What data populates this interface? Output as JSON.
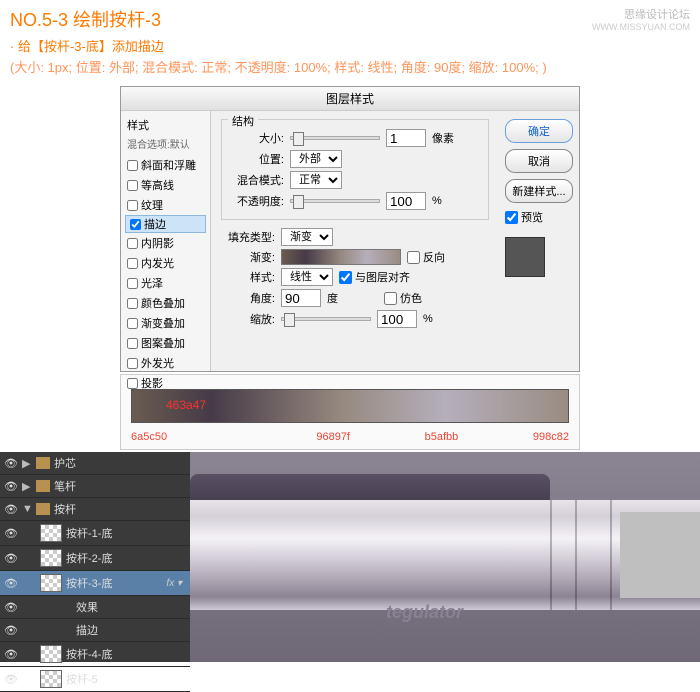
{
  "header": {
    "title": "NO.5-3 绘制按杆-3",
    "subtitle": "· 给【按杆-3-底】添加描边",
    "params": "(大小: 1px; 位置: 外部; 混合模式: 正常; 不透明度: 100%; 样式: 线性; 角度: 90度; 缩放: 100%; )",
    "watermark": "思缘设计论坛",
    "watermark_url": "WWW.MISSYUAN.COM"
  },
  "dialog": {
    "title": "图层样式",
    "left_head": "样式",
    "left_sub": "混合选项:默认",
    "styles": [
      {
        "label": "斜面和浮雕",
        "checked": false
      },
      {
        "label": "等高线",
        "checked": false
      },
      {
        "label": "纹理",
        "checked": false
      },
      {
        "label": "描边",
        "checked": true,
        "selected": true
      },
      {
        "label": "内阴影",
        "checked": false
      },
      {
        "label": "内发光",
        "checked": false
      },
      {
        "label": "光泽",
        "checked": false
      },
      {
        "label": "颜色叠加",
        "checked": false
      },
      {
        "label": "渐变叠加",
        "checked": false
      },
      {
        "label": "图案叠加",
        "checked": false
      },
      {
        "label": "外发光",
        "checked": false
      },
      {
        "label": "投影",
        "checked": false
      }
    ],
    "section_stroke": "描边",
    "group_struct": "结构",
    "size_label": "大小:",
    "size_val": "1",
    "size_unit": "像素",
    "pos_label": "位置:",
    "pos_val": "外部",
    "blend_label": "混合模式:",
    "blend_val": "正常",
    "opacity_label": "不透明度:",
    "opacity_val": "100",
    "pct": "%",
    "fill_label": "填充类型:",
    "fill_val": "渐变",
    "grad_label": "渐变:",
    "reverse": "反向",
    "style_label": "样式:",
    "style_val": "线性",
    "align": "与图层对齐",
    "angle_label": "角度:",
    "angle_val": "90",
    "deg": "度",
    "dither": "仿色",
    "scale_label": "缩放:",
    "scale_val": "100",
    "btn_ok": "确定",
    "btn_cancel": "取消",
    "btn_new": "新建样式...",
    "preview": "预览"
  },
  "gradient": {
    "inner": "463a47",
    "stops": [
      "6a5c50",
      "",
      "96897f",
      "b5afbb",
      "998c82"
    ]
  },
  "layers": {
    "items": [
      {
        "type": "folder",
        "name": "护芯"
      },
      {
        "type": "folder",
        "name": "笔杆"
      },
      {
        "type": "folder",
        "name": "按杆",
        "open": true
      },
      {
        "type": "layer",
        "name": "按杆-1-底",
        "indent": 1
      },
      {
        "type": "layer",
        "name": "按杆-2-底",
        "indent": 1
      },
      {
        "type": "layer",
        "name": "按杆-3-底",
        "indent": 1,
        "selected": true,
        "fx": "fx"
      },
      {
        "type": "fx",
        "name": "效果",
        "indent": 2
      },
      {
        "type": "fx",
        "name": "描边",
        "indent": 2
      },
      {
        "type": "layer",
        "name": "按杆-4-底",
        "indent": 1
      },
      {
        "type": "partial",
        "name": "按杆-5",
        "indent": 1
      }
    ]
  },
  "render_text": "tegulator"
}
